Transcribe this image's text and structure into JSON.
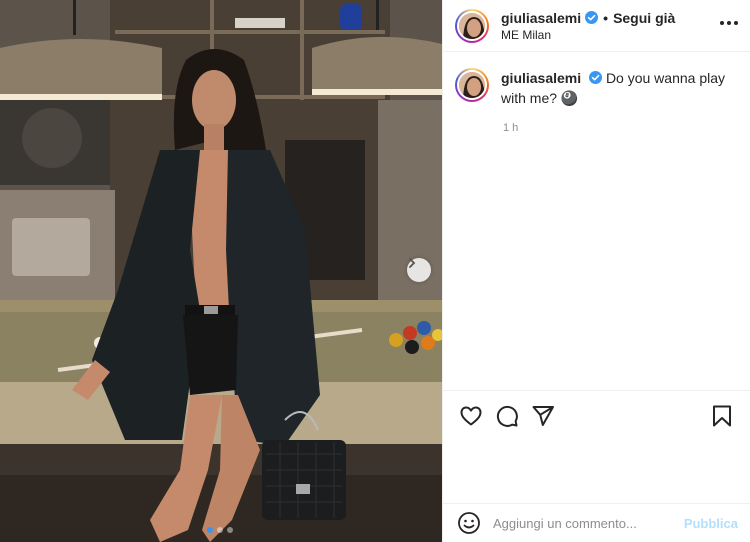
{
  "post": {
    "username": "giuliasalemi",
    "verified": true,
    "follow_label": "Segui già",
    "location": "ME Milan",
    "caption_text": "Do you wanna play with me?",
    "caption_emoji": "🎱",
    "time_ago": "1 h",
    "image_count": 3,
    "image_active_index": 0
  },
  "actions": {
    "like_icon": "heart-icon",
    "comment_icon": "comment-icon",
    "share_icon": "paper-plane-icon",
    "save_icon": "bookmark-icon"
  },
  "add_comment": {
    "placeholder": "Aggiungi un commento...",
    "publish_label": "Pubblica"
  },
  "colors": {
    "verified": "#3897f0",
    "publish_disabled": "#b2dffc",
    "carousel_active_dot": "#3797f0"
  }
}
